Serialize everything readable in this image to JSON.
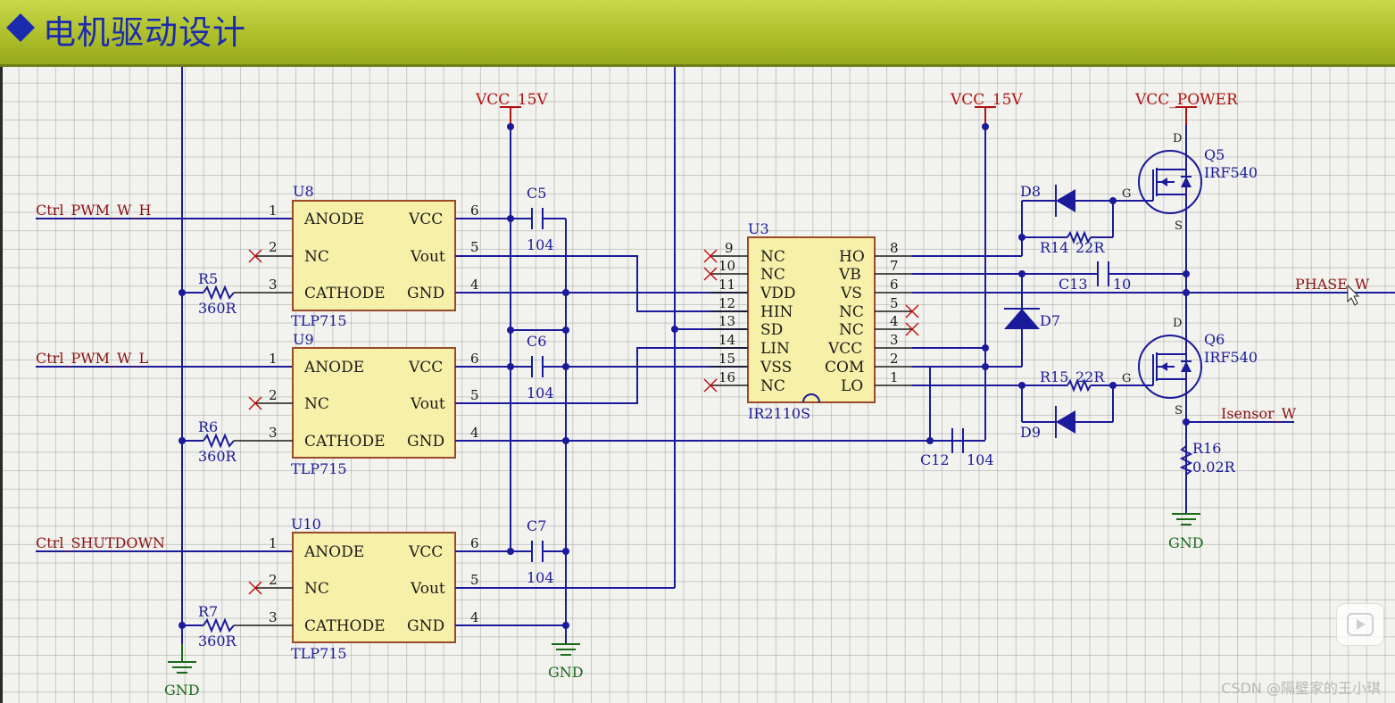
{
  "header": {
    "title": "电机驱动设计"
  },
  "colors": {
    "header_bg": "#aebf2a",
    "title_text": "#1a2bb0",
    "wire": "#1a1a9a",
    "power_label": "#b01010",
    "ground_label": "#1a6a1a",
    "chip_fill": "#f7f0a8"
  },
  "nets": {
    "ctrl_h": "Ctrl_PWM_W_H",
    "ctrl_l": "Ctrl_PWM_W_L",
    "ctrl_sd": "Ctrl_SHUTDOWN",
    "vcc1": "VCC_15V",
    "vcc2": "VCC_15V",
    "vcc_power": "VCC_POWER",
    "phase": "PHASE_W",
    "isensor": "Isensor_W",
    "gnd": "GND"
  },
  "optocouplers": [
    {
      "ref": "U8",
      "part": "TLP715",
      "pins": [
        "ANODE",
        "NC",
        "CATHODE",
        "VCC",
        "Vout",
        "GND"
      ],
      "nums": [
        "1",
        "2",
        "3",
        "6",
        "5",
        "4"
      ]
    },
    {
      "ref": "U9",
      "part": "TLP715",
      "pins": [
        "ANODE",
        "NC",
        "CATHODE",
        "VCC",
        "Vout",
        "GND"
      ],
      "nums": [
        "1",
        "2",
        "3",
        "6",
        "5",
        "4"
      ]
    },
    {
      "ref": "U10",
      "part": "TLP715",
      "pins": [
        "ANODE",
        "NC",
        "CATHODE",
        "VCC",
        "Vout",
        "GND"
      ],
      "nums": [
        "1",
        "2",
        "3",
        "6",
        "5",
        "4"
      ]
    }
  ],
  "resistors": [
    {
      "ref": "R5",
      "value": "360R"
    },
    {
      "ref": "R6",
      "value": "360R"
    },
    {
      "ref": "R7",
      "value": "360R"
    },
    {
      "ref": "R14",
      "value": "22R"
    },
    {
      "ref": "R15",
      "value": "22R"
    },
    {
      "ref": "R16",
      "value": "0.02R"
    }
  ],
  "capacitors": [
    {
      "ref": "C5",
      "value": "104"
    },
    {
      "ref": "C6",
      "value": "104"
    },
    {
      "ref": "C7",
      "value": "104"
    },
    {
      "ref": "C12",
      "value": "104"
    },
    {
      "ref": "C13",
      "value": "10"
    }
  ],
  "driver": {
    "ref": "U3",
    "part": "IR2110S",
    "left_pins": [
      {
        "num": "9",
        "name": "NC"
      },
      {
        "num": "10",
        "name": "NC"
      },
      {
        "num": "11",
        "name": "VDD"
      },
      {
        "num": "12",
        "name": "HIN"
      },
      {
        "num": "13",
        "name": "SD"
      },
      {
        "num": "14",
        "name": "LIN"
      },
      {
        "num": "15",
        "name": "VSS"
      },
      {
        "num": "16",
        "name": "NC"
      }
    ],
    "right_pins": [
      {
        "num": "8",
        "name": "HO"
      },
      {
        "num": "7",
        "name": "VB"
      },
      {
        "num": "6",
        "name": "VS"
      },
      {
        "num": "5",
        "name": "NC"
      },
      {
        "num": "4",
        "name": "NC"
      },
      {
        "num": "3",
        "name": "VCC"
      },
      {
        "num": "2",
        "name": "COM"
      },
      {
        "num": "1",
        "name": "LO"
      }
    ]
  },
  "diodes": [
    "D7",
    "D8",
    "D9"
  ],
  "mosfets": [
    {
      "ref": "Q5",
      "part": "IRF540"
    },
    {
      "ref": "Q6",
      "part": "IRF540"
    }
  ],
  "mosfet_pins": {
    "d": "D",
    "g": "G",
    "s": "S"
  },
  "watermark": "CSDN @隔壁家的王小琪"
}
